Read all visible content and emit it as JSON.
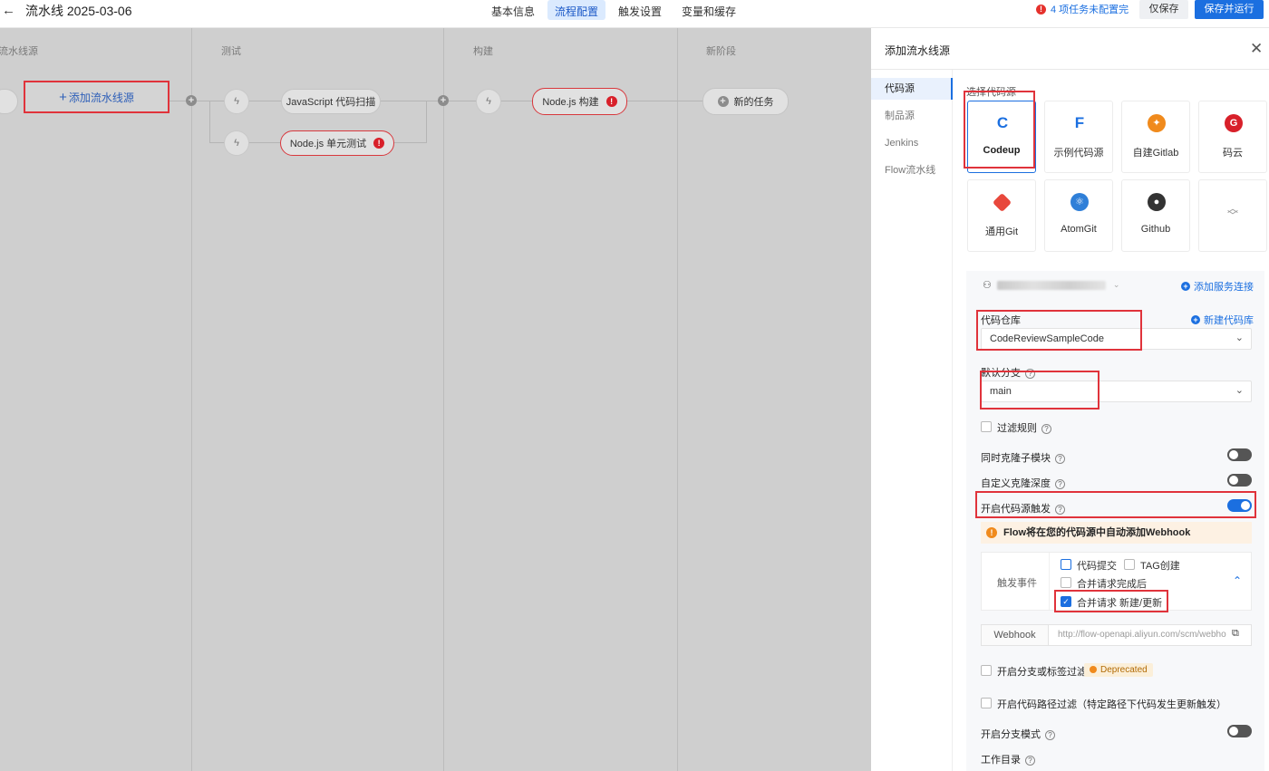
{
  "header": {
    "back_icon": "arrow-left-icon",
    "title": "流水线 2025-03-06",
    "tabs": [
      {
        "label": "基本信息",
        "active": false
      },
      {
        "label": "流程配置",
        "active": true
      },
      {
        "label": "触发设置",
        "active": false
      },
      {
        "label": "变量和缓存",
        "active": false
      }
    ],
    "warning": "4 项任务未配置完",
    "save_only": "仅保存",
    "save_run": "保存并运行",
    "accent": "#1b6fe0"
  },
  "canvas": {
    "stages": [
      "流水线源",
      "测试",
      "构建",
      "新阶段"
    ],
    "add_source": "添加流水线源",
    "tasks": {
      "js_scan": "JavaScript 代码扫描",
      "node_unit": "Node.js 单元测试",
      "node_build": "Node.js 构建",
      "new_task": "新的任务"
    }
  },
  "panel": {
    "title": "添加流水线源",
    "close_icon": "close-icon",
    "side": [
      "代码源",
      "制品源",
      "Jenkins",
      "Flow流水线"
    ],
    "select_label": "选择代码源",
    "sources": [
      {
        "label": "Codeup",
        "icon": "codeup-icon",
        "color": "#1b6fe0",
        "selected": true
      },
      {
        "label": "示例代码源",
        "icon": "sample-code-icon",
        "color": "#1b6fe0",
        "selected": false
      },
      {
        "label": "自建Gitlab",
        "icon": "gitlab-icon",
        "color": "#f08a1c",
        "selected": false
      },
      {
        "label": "码云",
        "icon": "gitee-icon",
        "color": "#d8202a",
        "selected": false
      },
      {
        "label": "通用Git",
        "icon": "git-icon",
        "color": "#e8483c",
        "selected": false
      },
      {
        "label": "AtomGit",
        "icon": "atomgit-icon",
        "color": "#2f7fd8",
        "selected": false
      },
      {
        "label": "Github",
        "icon": "github-icon",
        "color": "#333333",
        "selected": false
      }
    ],
    "add_service_connection": "添加服务连接",
    "repo_label": "代码仓库",
    "new_repo": "新建代码库",
    "repo_value": "CodeReviewSampleCode",
    "branch_label": "默认分支",
    "branch_value": "main",
    "filter_rules": "过滤规则",
    "clone_submodules": "同时克隆子模块",
    "custom_clone_depth": "自定义克隆深度",
    "enable_trigger": "开启代码源触发",
    "notice": "Flow将在您的代码源中自动添加Webhook",
    "trigger_events_label": "触发事件",
    "events": {
      "code_commit": "代码提交",
      "tag_create": "TAG创建",
      "merge_done": "合并请求完成后",
      "merge_new": "合并请求 新建/更新"
    },
    "webhook_label": "Webhook",
    "webhook_url": "http://flow-openapi.aliyun.com/scm/webhook",
    "branch_tag_filter": "开启分支或标签过滤",
    "deprecated": "Deprecated",
    "path_filter": "开启代码路径过滤（特定路径下代码发生更新触发）",
    "branch_mode": "开启分支模式",
    "work_dir": "工作目录"
  }
}
